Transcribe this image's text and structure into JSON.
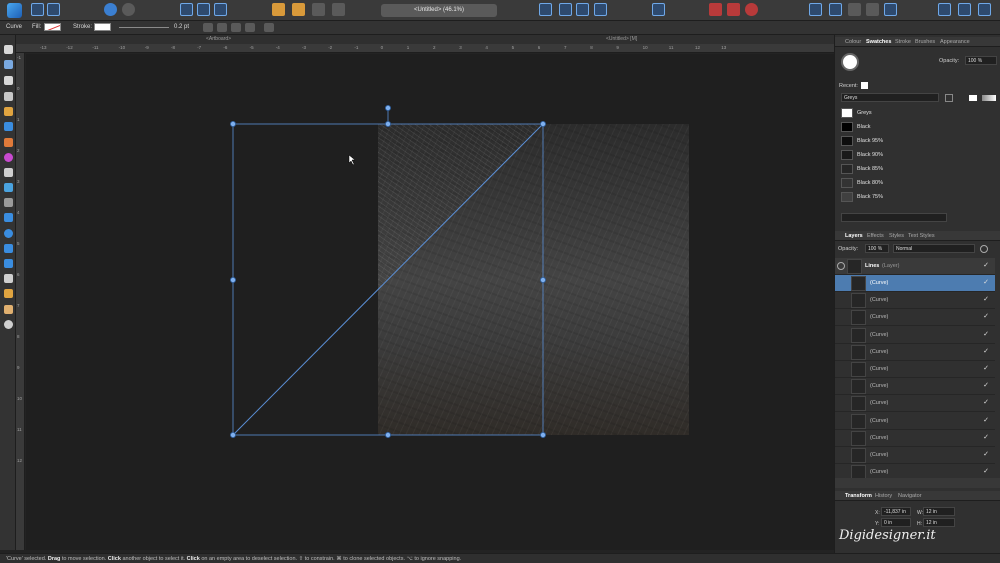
{
  "app": {
    "document_title": "<Untitled> (46.1%)",
    "tab_left": "<Artboard>",
    "tab_right": "<Untitled> [M]"
  },
  "context_toolbar": {
    "tool_name": "Curve",
    "fill_label": "Fill:",
    "stroke_label": "Stroke:",
    "stroke_width": "0.2 pt"
  },
  "ruler": {
    "h_ticks": [
      "-13",
      "-12",
      "-11",
      "-10",
      "-9",
      "-8",
      "-7",
      "-6",
      "-5",
      "-4",
      "-3",
      "-2",
      "-1",
      "0",
      "1",
      "2",
      "3",
      "4",
      "5",
      "6",
      "7",
      "8",
      "9",
      "10",
      "11",
      "12",
      "13"
    ],
    "v_ticks": [
      "-1",
      "0",
      "1",
      "2",
      "3",
      "4",
      "5",
      "6",
      "7",
      "8",
      "9",
      "10",
      "11",
      "12"
    ]
  },
  "swatches_panel": {
    "tabs": [
      "Colour",
      "Swatches",
      "Stroke",
      "Brushes",
      "Appearance"
    ],
    "active_tab": "Swatches",
    "opacity_label": "Opacity:",
    "opacity_value": "100 %",
    "recent_label": "Recent:",
    "palette_name": "Greys",
    "items": [
      {
        "name": "Greys",
        "color": "#ffffff"
      },
      {
        "name": "Black",
        "color": "#000000"
      },
      {
        "name": "Black 95%",
        "color": "#0d0d0d"
      },
      {
        "name": "Black 90%",
        "color": "#1a1a1a"
      },
      {
        "name": "Black 85%",
        "color": "#262626"
      },
      {
        "name": "Black 80%",
        "color": "#333333"
      },
      {
        "name": "Black 75%",
        "color": "#404040"
      }
    ]
  },
  "layers_panel": {
    "tabs": [
      "Layers",
      "Effects",
      "Styles",
      "Text Styles"
    ],
    "active_tab": "Layers",
    "opacity_label": "Opacity:",
    "opacity_value": "100 %",
    "blend_mode": "Normal",
    "parent_layer": "Lines",
    "parent_layer_kind": "(Layer)",
    "child_rows": [
      "(Curve)",
      "(Curve)",
      "(Curve)",
      "(Curve)",
      "(Curve)",
      "(Curve)",
      "(Curve)",
      "(Curve)",
      "(Curve)",
      "(Curve)",
      "(Curve)",
      "(Curve)"
    ]
  },
  "transform_panel": {
    "tabs": [
      "Transform",
      "History",
      "Navigator"
    ],
    "active_tab": "Transform",
    "x_label": "X:",
    "x_value": "-11,837 in",
    "y_label": "Y:",
    "y_value": "0 in",
    "w_label": "W:",
    "w_value": "12 in",
    "h_label": "H:",
    "h_value": "12 in",
    "watermark": "Digidesigner.it"
  },
  "statusbar": {
    "part1": "'Curve' selected. ",
    "b1": "Drag",
    "part2": " to move selection. ",
    "b2": "Click",
    "part3": " another object to select it. ",
    "b3": "Click",
    "part4": " on an empty area to deselect selection. ⇧ to constrain. ⌘ to clone selected objects. ⌥ to ignore snapping."
  },
  "colors": {
    "selection": "#5b8fd6",
    "accent": "#3b7fd1",
    "selected_row": "#4d7cb0"
  }
}
